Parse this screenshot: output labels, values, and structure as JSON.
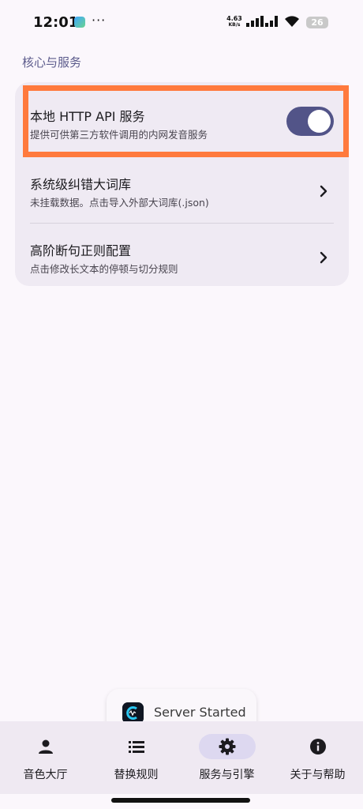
{
  "status_bar": {
    "time": "12:01",
    "dots": "···",
    "net_speed_value": "4.63",
    "net_speed_unit": "KB/s",
    "battery": "26"
  },
  "section": {
    "title": "核心与服务"
  },
  "settings": [
    {
      "title": "本地 HTTP API 服务",
      "subtitle": "提供可供第三方软件调用的内网发音服务",
      "control": "toggle",
      "toggle_on": true
    },
    {
      "title": "系统级纠错大词库",
      "subtitle": "未挂载数据。点击导入外部大词库(.json)",
      "control": "chevron"
    },
    {
      "title": "高阶断句正则配置",
      "subtitle": "点击修改长文本的停顿与切分规则",
      "control": "chevron"
    }
  ],
  "toast": {
    "text": "Server Started"
  },
  "nav": [
    {
      "label": "音色大厅",
      "icon": "person-icon",
      "active": false
    },
    {
      "label": "替换规则",
      "icon": "list-icon",
      "active": false
    },
    {
      "label": "服务与引擎",
      "icon": "gear-icon",
      "active": true
    },
    {
      "label": "关于与帮助",
      "icon": "info-icon",
      "active": false
    }
  ],
  "colors": {
    "accent": "#525488",
    "highlight": "#ff7a3d",
    "background": "#fbf7fc",
    "card": "#efeaf3",
    "active_pill": "#ddd8f0"
  }
}
